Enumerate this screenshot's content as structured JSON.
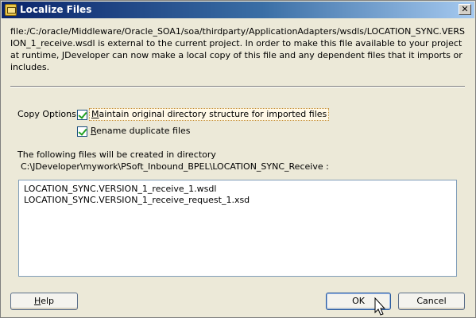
{
  "window": {
    "title": "Localize Files",
    "close_glyph": "✕"
  },
  "description": "file:/C:/oracle/Middleware/Oracle_SOA1/soa/thirdparty/ApplicationAdapters/wsdls/LOCATION_SYNC.VERSION_1_receive.wsdl is external to the current project. In order to make this file available to your project at runtime, JDeveloper can now make a local copy of this file and any dependent files that it imports or includes.",
  "copy_options": {
    "label": "Copy Options:",
    "maintain": {
      "mnemonic": "M",
      "rest": "aintain original directory structure for imported files",
      "checked": true
    },
    "rename": {
      "mnemonic": "R",
      "rest": "ename duplicate files",
      "checked": true
    }
  },
  "files": {
    "label": "The following files will be created in directory",
    "path": "C:\\JDeveloper\\mywork\\PSoft_Inbound_BPEL\\LOCATION_SYNC_Receive :",
    "items": [
      "LOCATION_SYNC.VERSION_1_receive_1.wsdl",
      "LOCATION_SYNC.VERSION_1_receive_request_1.xsd"
    ]
  },
  "buttons": {
    "help_mnemonic": "H",
    "help_rest": "elp",
    "ok": "OK",
    "cancel": "Cancel"
  },
  "icons": {
    "title": "folder-icon",
    "close": "close-icon",
    "cursor": "mouse-pointer-icon"
  }
}
